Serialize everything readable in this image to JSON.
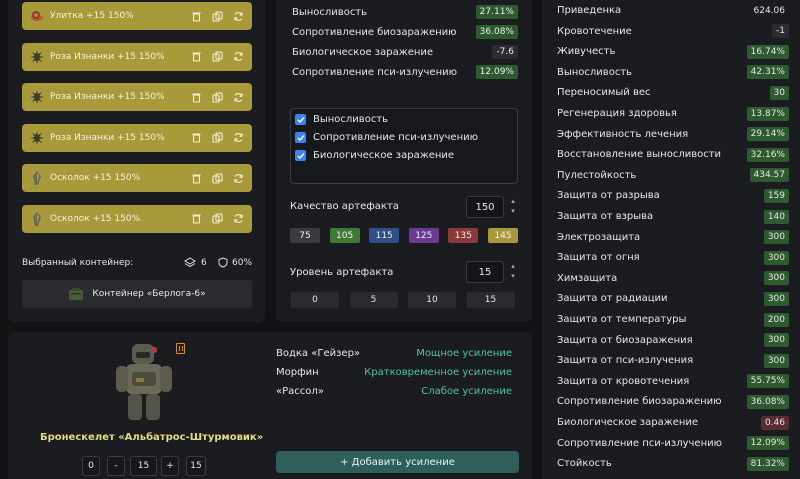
{
  "artifacts": [
    {
      "name": "Улитка +15 150%",
      "icon": "snail-icon"
    },
    {
      "name": "Роза Изнанки +15 150%",
      "icon": "rose-icon"
    },
    {
      "name": "Роза Изнанки +15 150%",
      "icon": "rose-icon"
    },
    {
      "name": "Роза Изнанки +15 150%",
      "icon": "rose-icon"
    },
    {
      "name": "Осколок +15 150%",
      "icon": "shard-icon"
    },
    {
      "name": "Осколок +15 150%",
      "icon": "shard-icon"
    }
  ],
  "container": {
    "selected_label": "Выбранный контейнер:",
    "slots": "6",
    "protection": "60%",
    "name": "Контейнер «Берлога-6»"
  },
  "middle_stats": [
    {
      "label": "Выносливость",
      "value": "27.11%",
      "tone": "green"
    },
    {
      "label": "Сопротивление биозаражению",
      "value": "36.08%",
      "tone": "green"
    },
    {
      "label": "Биологическое заражение",
      "value": "-7.6",
      "tone": "dark"
    },
    {
      "label": "Сопротивление пси-излучению",
      "value": "12.09%",
      "tone": "green"
    }
  ],
  "filters": [
    {
      "label": "Выносливость",
      "checked": true
    },
    {
      "label": "Сопротивление пси-излучению",
      "checked": true
    },
    {
      "label": "Биологическое заражение",
      "checked": true
    }
  ],
  "quality": {
    "label": "Качество артефакта",
    "value": "150",
    "presets": [
      {
        "label": "75",
        "color": "#3a3b3f"
      },
      {
        "label": "105",
        "color": "#3f7a35"
      },
      {
        "label": "115",
        "color": "#2f4f86"
      },
      {
        "label": "125",
        "color": "#6a3a92"
      },
      {
        "label": "135",
        "color": "#8a3a3a"
      },
      {
        "label": "145",
        "color": "#a8993b"
      }
    ]
  },
  "level": {
    "label": "Уровень артефакта",
    "value": "15",
    "presets": [
      "0",
      "5",
      "10",
      "15"
    ]
  },
  "armor": {
    "name": "Бронескелет «Альбатрос-Штурмовик»",
    "stepper": [
      "0",
      "-",
      "15",
      "+",
      "15"
    ]
  },
  "boosts": [
    {
      "item": "Водка «Гейзер»",
      "effect": "Мощное усиление"
    },
    {
      "item": "Морфин",
      "effect": "Кратковременное усиление"
    },
    {
      "item": "«Рассол»",
      "effect": "Слабое усиление"
    }
  ],
  "add_boost_label": "+ Добавить усиление",
  "right_stats": [
    {
      "label": "Приведенка",
      "value": "624.06",
      "tone": "none"
    },
    {
      "label": "Кровотечение",
      "value": "-1",
      "tone": "dark"
    },
    {
      "label": "Живучесть",
      "value": "16.74%",
      "tone": "green"
    },
    {
      "label": "Выносливость",
      "value": "42.31%",
      "tone": "green"
    },
    {
      "label": "Переносимый вес",
      "value": "30",
      "tone": "green"
    },
    {
      "label": "Регенерация здоровья",
      "value": "13.87%",
      "tone": "green"
    },
    {
      "label": "Эффективность лечения",
      "value": "29.14%",
      "tone": "green"
    },
    {
      "label": "Восстановление выносливости",
      "value": "32.16%",
      "tone": "green"
    },
    {
      "label": "Пулестойкость",
      "value": "434.57",
      "tone": "green"
    },
    {
      "label": "Защита от разрыва",
      "value": "159",
      "tone": "green"
    },
    {
      "label": "Защита от взрыва",
      "value": "140",
      "tone": "green"
    },
    {
      "label": "Электрозащита",
      "value": "300",
      "tone": "green"
    },
    {
      "label": "Защита от огня",
      "value": "300",
      "tone": "green"
    },
    {
      "label": "Химзащита",
      "value": "300",
      "tone": "green"
    },
    {
      "label": "Защита от радиации",
      "value": "300",
      "tone": "green"
    },
    {
      "label": "Защита от температуры",
      "value": "200",
      "tone": "green"
    },
    {
      "label": "Защита от биозаражения",
      "value": "300",
      "tone": "green"
    },
    {
      "label": "Защита от пси-излучения",
      "value": "300",
      "tone": "green"
    },
    {
      "label": "Защита от кровотечения",
      "value": "55.75%",
      "tone": "green"
    },
    {
      "label": "Сопротивление биозаражению",
      "value": "36.08%",
      "tone": "green"
    },
    {
      "label": "Биологическое заражение",
      "value": "0.46",
      "tone": "red"
    },
    {
      "label": "Сопротивление пси-излучению",
      "value": "12.09%",
      "tone": "green"
    },
    {
      "label": "Стойкость",
      "value": "81.32%",
      "tone": "green"
    }
  ]
}
